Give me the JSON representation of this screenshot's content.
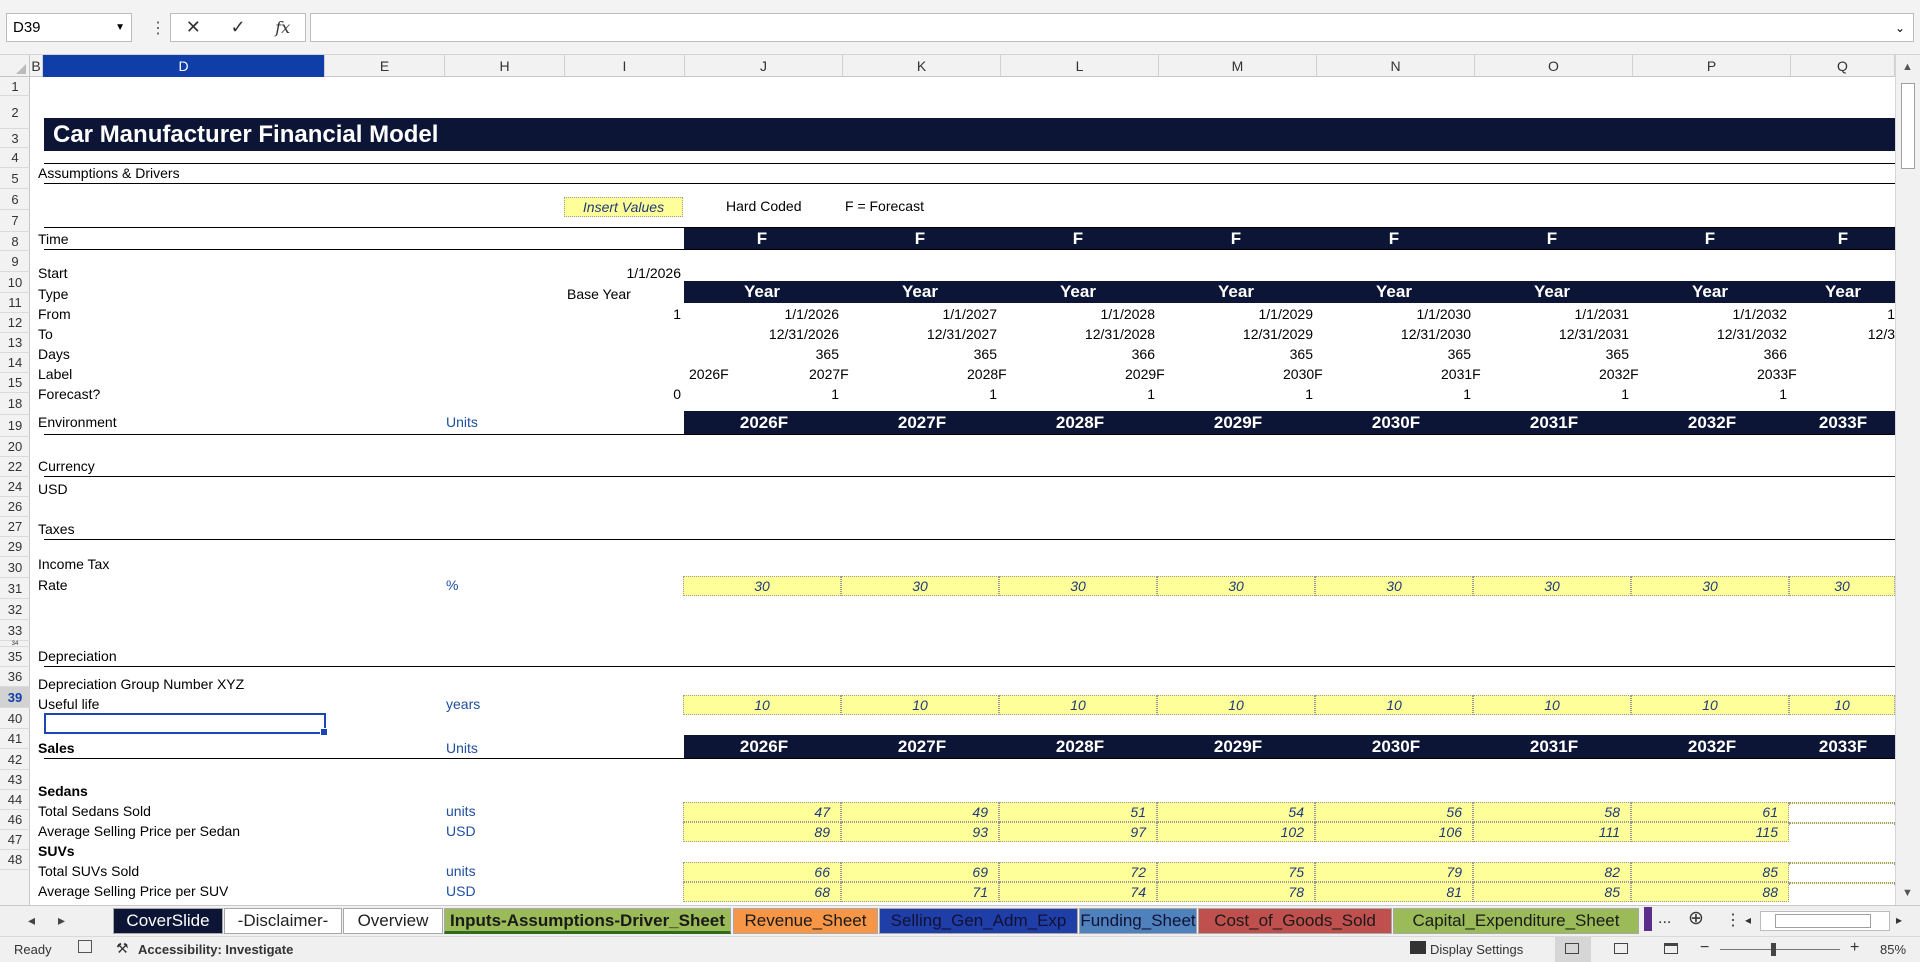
{
  "formula_bar": {
    "name_box": "D39",
    "cancel_icon": "✕",
    "enter_icon": "✓",
    "fx_icon": "fx",
    "formula": ""
  },
  "columns": [
    {
      "key": "B",
      "label": "B"
    },
    {
      "key": "D",
      "label": "D"
    },
    {
      "key": "E",
      "label": "E"
    },
    {
      "key": "H",
      "label": "H"
    },
    {
      "key": "I",
      "label": "I"
    },
    {
      "key": "J",
      "label": "J"
    },
    {
      "key": "K",
      "label": "K"
    },
    {
      "key": "L",
      "label": "L"
    },
    {
      "key": "M",
      "label": "M"
    },
    {
      "key": "N",
      "label": "N"
    },
    {
      "key": "O",
      "label": "O"
    },
    {
      "key": "P",
      "label": "P"
    },
    {
      "key": "Q",
      "label": "Q"
    }
  ],
  "rows": [
    "1",
    "2",
    "3",
    "4",
    "5",
    "6",
    "7",
    "8",
    "9",
    "10",
    "11",
    "12",
    "13",
    "14",
    "15",
    "18",
    "19",
    "20",
    "22",
    "24",
    "26",
    "27",
    "29",
    "30",
    "31",
    "32",
    "33",
    "34",
    "35",
    "36",
    "39",
    "40",
    "41",
    "42",
    "43",
    "44",
    "46",
    "47",
    "48"
  ],
  "sheet": {
    "title": "Car Manufacturer Financial Model",
    "assumptions_label": "Assumptions & Drivers",
    "legend": {
      "insert": "Insert Values",
      "hard_coded": "Hard Coded",
      "forecast": "F = Forecast"
    },
    "time": {
      "label": "Time",
      "flags": [
        "F",
        "F",
        "F",
        "F",
        "F",
        "F",
        "F",
        "F"
      ],
      "start_label": "Start",
      "start_value": "1/1/2026",
      "type_label": "Type",
      "type_base": "Base Year",
      "types": [
        "Year",
        "Year",
        "Year",
        "Year",
        "Year",
        "Year",
        "Year",
        "Year"
      ],
      "from_label": "From",
      "from_base": "1",
      "from": [
        "1/1/2026",
        "1/1/2027",
        "1/1/2028",
        "1/1/2029",
        "1/1/2030",
        "1/1/2031",
        "1/1/2032",
        "1"
      ],
      "to_label": "To",
      "to": [
        "12/31/2026",
        "12/31/2027",
        "12/31/2028",
        "12/31/2029",
        "12/31/2030",
        "12/31/2031",
        "12/31/2032",
        "12/3"
      ],
      "days_label": "Days",
      "days": [
        "365",
        "365",
        "366",
        "365",
        "365",
        "365",
        "366"
      ],
      "label_label": "Label",
      "labels": [
        "2026F",
        "2027F",
        "2028F",
        "2029F",
        "2030F",
        "2031F",
        "2032F",
        "2033F"
      ],
      "forecast_label": "Forecast?",
      "forecast_base": "0",
      "forecast": [
        "1",
        "1",
        "1",
        "1",
        "1",
        "1",
        "1"
      ]
    },
    "years": [
      "2026F",
      "2027F",
      "2028F",
      "2029F",
      "2030F",
      "2031F",
      "2032F",
      "2033F"
    ],
    "environment": {
      "label": "Environment",
      "units": "Units"
    },
    "currency": {
      "label": "Currency",
      "value": "USD"
    },
    "taxes": {
      "label": "Taxes",
      "income_tax": "Income Tax",
      "rate_label": "Rate",
      "rate_unit": "%",
      "rates": [
        "30",
        "30",
        "30",
        "30",
        "30",
        "30",
        "30",
        "30"
      ]
    },
    "depreciation": {
      "label": "Depreciation",
      "group": "Depreciation Group Number XYZ",
      "life_label": "Useful life",
      "life_unit": "years",
      "life": [
        "10",
        "10",
        "10",
        "10",
        "10",
        "10",
        "10",
        "10"
      ]
    },
    "sales": {
      "label": "Sales",
      "units": "Units",
      "sedans_label": "Sedans",
      "sedans_sold_label": "Total Sedans Sold",
      "sedans_sold_unit": "units",
      "sedans_sold": [
        "47",
        "49",
        "51",
        "54",
        "56",
        "58",
        "61",
        ""
      ],
      "sedan_price_label": "Average Selling Price per Sedan",
      "sedan_price_unit": "USD",
      "sedan_price": [
        "89",
        "93",
        "97",
        "102",
        "106",
        "111",
        "115",
        ""
      ],
      "suvs_label": "SUVs",
      "suvs_sold_label": "Total SUVs Sold",
      "suvs_sold_unit": "units",
      "suvs_sold": [
        "66",
        "69",
        "72",
        "75",
        "79",
        "82",
        "85",
        ""
      ],
      "suv_price_label": "Average Selling Price per SUV",
      "suv_price_unit": "USD",
      "suv_price": [
        "68",
        "71",
        "74",
        "78",
        "81",
        "85",
        "88",
        ""
      ]
    }
  },
  "tabs": [
    {
      "label": "CoverSlide",
      "bg": "#0c1535",
      "fg": "#ffffff"
    },
    {
      "label": "-Disclaimer-",
      "bg": "#ffffff",
      "fg": "#222222"
    },
    {
      "label": "Overview",
      "bg": "#ffffff",
      "fg": "#222222"
    },
    {
      "label": "Inputs-Assumptions-Driver_Sheet",
      "bg": "#9bbb59",
      "fg": "#1a1a1a",
      "active": true
    },
    {
      "label": "Revenue_Sheet",
      "bg": "#f79646",
      "fg": "#1a1a1a"
    },
    {
      "label": "Selling_Gen_Adm_Exp",
      "bg": "#1f3ea8",
      "fg": "#111133"
    },
    {
      "label": "Funding_Sheet",
      "bg": "#4f81bd",
      "fg": "#111133"
    },
    {
      "label": "Cost_of_Goods_Sold",
      "bg": "#c0504d",
      "fg": "#1a1a1a"
    },
    {
      "label": "Capital_Expenditure_Sheet",
      "bg": "#9bbb59",
      "fg": "#1a1a1a"
    }
  ],
  "tab_more": "...",
  "status": {
    "ready": "Ready",
    "accessibility": "Accessibility: Investigate",
    "display_settings": "Display Settings",
    "zoom_minus": "−",
    "zoom_plus": "+",
    "zoom": "85%"
  }
}
